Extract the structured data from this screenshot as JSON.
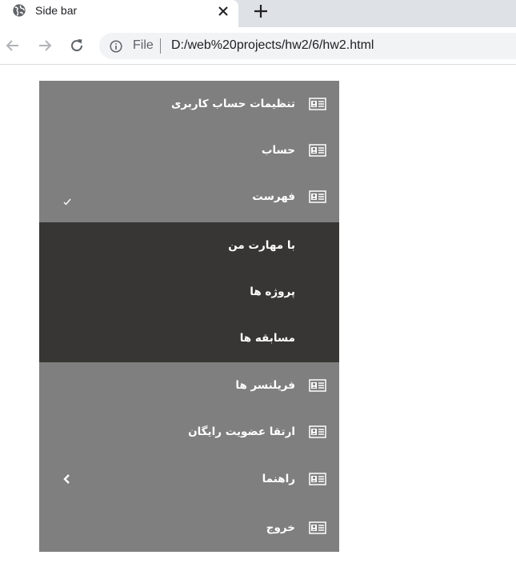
{
  "browser": {
    "tab_title": "Side bar",
    "address_scheme": "File",
    "address_url": "D:/web%20projects/hw2/6/hw2.html"
  },
  "sidebar": {
    "items_top": [
      {
        "label": "تنظیمات حساب کاربری",
        "icon": "contact-card-icon"
      },
      {
        "label": "حساب",
        "icon": "contact-card-icon"
      },
      {
        "label": "فهرست",
        "icon": "contact-card-icon",
        "arrow": "check-icon"
      }
    ],
    "submenu": [
      {
        "label": "با مهارت من"
      },
      {
        "label": "پروژه ها"
      },
      {
        "label": "مسابقه ها"
      }
    ],
    "items_bottom": [
      {
        "label": "فریلنسر ها",
        "icon": "contact-card-icon"
      },
      {
        "label": "ارتقا عضویت رایگان",
        "icon": "contact-card-icon"
      },
      {
        "label": "راهنما",
        "icon": "contact-card-icon",
        "arrow": "chevron-left-icon"
      },
      {
        "label": "خروج",
        "icon": "contact-card-icon"
      }
    ]
  },
  "colors": {
    "sidebar_bg": "#7f7f7f",
    "submenu_bg": "#383634",
    "text": "#ffffff"
  }
}
